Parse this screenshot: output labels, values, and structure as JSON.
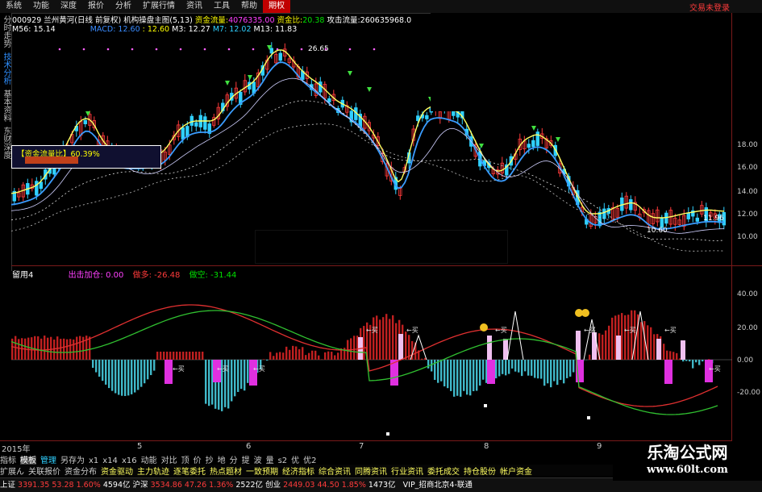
{
  "menu": {
    "items": [
      "系统",
      "功能",
      "深度",
      "报价",
      "分析",
      "扩展行情",
      "资讯",
      "工具",
      "帮助"
    ],
    "active": "期权",
    "right_label": "交易未登录"
  },
  "side_tabs": [
    "分时走势",
    "技术分析",
    "基本资料",
    "东财深度"
  ],
  "header": {
    "code": "000929",
    "name": "兰州黄河(日线 前复权)",
    "indicator": "机构操盘主图(5,13)",
    "fund_flow_label": "资金流量:",
    "fund_flow_value": "4076335.00",
    "fund_ratio_label": "资金比:",
    "fund_ratio_value": "20.38",
    "attack_label": "攻击流量:",
    "attack_value": "260635968.0"
  },
  "ma_line": {
    "m56": "M56: 15.14",
    "macd": "MACD: 12.60",
    "m1": ": 12.60",
    "m3": "M3: 12.27",
    "m7": "M7: 12.02",
    "m13": "M13: 11.83"
  },
  "main_chart": {
    "price_labels": [
      "18.00",
      "16.00",
      "14.00",
      "12.00",
      "10.00"
    ],
    "high_annot": "26.65",
    "low_annot": "10.60",
    "last_annot": "11.96",
    "box_label": "【资金流量比】60.39%"
  },
  "sub_chart": {
    "name": "留用4",
    "out_label": "出击加仓: 0.00",
    "long_label": "做多: -26.48",
    "short_label": "做空: -31.44",
    "y_labels": [
      "40.00",
      "20.00",
      "0.00",
      "-20.00"
    ],
    "buy_mark": "买"
  },
  "date_axis": {
    "year": "2015年",
    "months": [
      "5",
      "6",
      "7",
      "8",
      "9"
    ]
  },
  "toolbar1": [
    "指标",
    "模板",
    "管理",
    "另存为",
    "x1",
    "x14",
    "x16",
    "动能",
    "对比",
    "顶",
    "价",
    "抄",
    "地",
    "分",
    "提",
    "波",
    "量",
    "s2",
    "优",
    "优2"
  ],
  "toolbar2": [
    "扩展ん",
    "关联报价",
    "资金分布",
    "资金驱动",
    "主力轨迹",
    "逐笔委托",
    "热点题材",
    "一致预期",
    "经济指标",
    "综合资讯",
    "同腾资讯",
    "行业资讯",
    "委托成交",
    "持仓股份",
    "帐户资金"
  ],
  "status": {
    "sh_label": "上证",
    "sh_value": "3391.35",
    "sh_change": "53.28",
    "sh_pct": "1.60%",
    "sh_vol": "4594亿",
    "sz_label": "沪深",
    "sz_value": "3534.86",
    "sz_change": "47.26",
    "sz_pct": "1.36%",
    "sz_vol": "2522亿",
    "cy_label": "创业",
    "cy_value": "2449.03",
    "cy_change": "44.50",
    "cy_pct": "1.85%",
    "cy_vol": "1473亿",
    "server": "VIP_招商北京4-联通"
  },
  "watermark": {
    "line1": "乐淘公式网",
    "line2": "www.60lt.com"
  },
  "colors": {
    "up": "#ff3b3b",
    "down": "#30d0ff",
    "ma_yellow": "#ffff60",
    "ma_blue": "#3a9cff",
    "accent": "#c00000"
  }
}
